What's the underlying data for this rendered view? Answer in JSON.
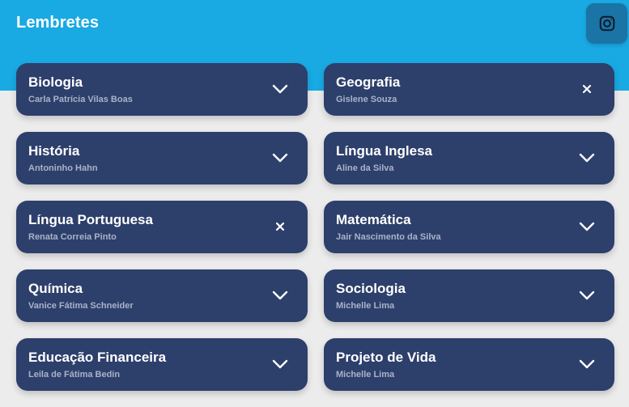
{
  "header": {
    "title": "Lembretes",
    "instagram_icon": "instagram-icon"
  },
  "colors": {
    "header_bg": "#19a9e3",
    "card_bg": "#2d3f6b",
    "page_bg": "#ececec",
    "instagram_btn": "#1a74a5"
  },
  "cards": [
    {
      "subject": "Biologia",
      "teacher": "Carla Patrícia Vilas Boas",
      "state": "collapsed",
      "icon": "chevron-down-icon"
    },
    {
      "subject": "Geografia",
      "teacher": "Gislene Souza",
      "state": "expanded",
      "icon": "close-icon"
    },
    {
      "subject": "História",
      "teacher": "Antoninho Hahn",
      "state": "collapsed",
      "icon": "chevron-down-icon"
    },
    {
      "subject": "Língua Inglesa",
      "teacher": "Aline da Silva",
      "state": "collapsed",
      "icon": "chevron-down-icon"
    },
    {
      "subject": "Língua Portuguesa",
      "teacher": "Renata Correia Pinto",
      "state": "expanded",
      "icon": "close-icon"
    },
    {
      "subject": "Matemática",
      "teacher": "Jair Nascimento da Silva",
      "state": "collapsed",
      "icon": "chevron-down-icon"
    },
    {
      "subject": "Química",
      "teacher": "Vanice Fátima Schneider",
      "state": "collapsed",
      "icon": "chevron-down-icon"
    },
    {
      "subject": "Sociologia",
      "teacher": "Michelle Lima",
      "state": "collapsed",
      "icon": "chevron-down-icon"
    },
    {
      "subject": "Educação Financeira",
      "teacher": "Leila de Fátima Bedin",
      "state": "collapsed",
      "icon": "chevron-down-icon"
    },
    {
      "subject": "Projeto de Vida",
      "teacher": "Michelle Lima",
      "state": "collapsed",
      "icon": "chevron-down-icon"
    }
  ]
}
